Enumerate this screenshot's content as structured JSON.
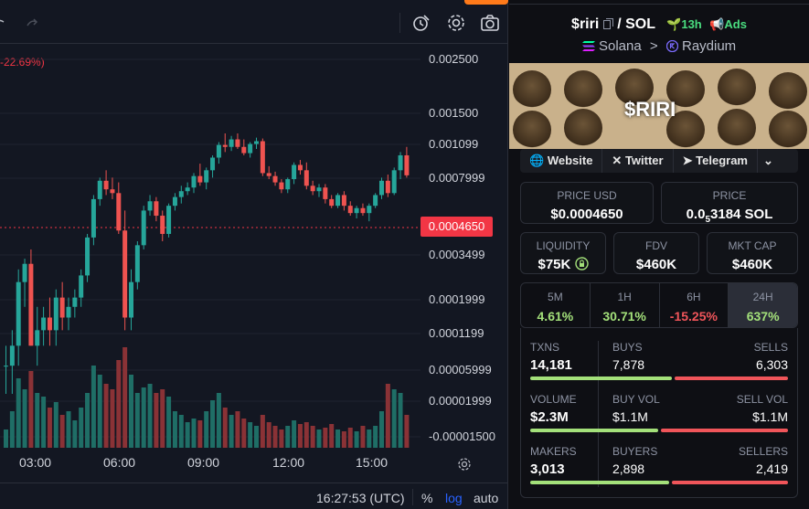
{
  "chart": {
    "change": "-22.69%)",
    "current_price": "0.0004650",
    "y_ticks": [
      "0.002500",
      "0.001500",
      "0.001099",
      "0.0007999",
      "0.0003499",
      "0.0001999",
      "0.0001199",
      "0.00005999",
      "0.00001999",
      "-0.00001500"
    ],
    "x_ticks": [
      "03:00",
      "06:00",
      "09:00",
      "12:00",
      "15:00"
    ],
    "time": "16:27:53 (UTC)",
    "percent": "%",
    "log": "log",
    "auto": "auto"
  },
  "chart_data": {
    "type": "candlestick",
    "x_ticks": [
      "03:00",
      "06:00",
      "09:00",
      "12:00",
      "15:00"
    ],
    "scale": "log",
    "candles": [
      {
        "o": 3e-05,
        "h": 4e-05,
        "l": 2e-05,
        "c": 3e-05,
        "v": 10
      },
      {
        "o": 3e-05,
        "h": 5e-05,
        "l": 2e-05,
        "c": 4e-05,
        "v": 20
      },
      {
        "o": 4e-05,
        "h": 0.00012,
        "l": 3e-05,
        "c": 0.0001,
        "v": 38
      },
      {
        "o": 0.0001,
        "h": 0.00014,
        "l": 7e-05,
        "c": 0.00013,
        "v": 32
      },
      {
        "o": 0.00013,
        "h": 0.00016,
        "l": 4e-05,
        "c": 4e-05,
        "v": 42
      },
      {
        "o": 4e-05,
        "h": 7e-05,
        "l": 3e-05,
        "c": 5e-05,
        "v": 30
      },
      {
        "o": 5e-05,
        "h": 7e-05,
        "l": 4e-05,
        "c": 6e-05,
        "v": 28
      },
      {
        "o": 6e-05,
        "h": 8e-05,
        "l": 4e-05,
        "c": 5e-05,
        "v": 22
      },
      {
        "o": 5e-05,
        "h": 9e-05,
        "l": 4e-05,
        "c": 8e-05,
        "v": 25
      },
      {
        "o": 8e-05,
        "h": 0.0001,
        "l": 5e-05,
        "c": 6e-05,
        "v": 18
      },
      {
        "o": 6e-05,
        "h": 8e-05,
        "l": 5e-05,
        "c": 7e-05,
        "v": 20
      },
      {
        "o": 7e-05,
        "h": 9e-05,
        "l": 6e-05,
        "c": 8e-05,
        "v": 15
      },
      {
        "o": 8e-05,
        "h": 0.00012,
        "l": 7e-05,
        "c": 0.00011,
        "v": 22
      },
      {
        "o": 0.00011,
        "h": 0.0002,
        "l": 0.0001,
        "c": 0.00019,
        "v": 30
      },
      {
        "o": 0.00019,
        "h": 0.00035,
        "l": 0.00017,
        "c": 0.00033,
        "v": 45
      },
      {
        "o": 0.00033,
        "h": 0.00045,
        "l": 0.0003,
        "c": 0.00043,
        "v": 40
      },
      {
        "o": 0.00043,
        "h": 0.0005,
        "l": 0.00035,
        "c": 0.00038,
        "v": 35
      },
      {
        "o": 0.00038,
        "h": 0.00045,
        "l": 0.00033,
        "c": 0.00036,
        "v": 32
      },
      {
        "o": 0.00036,
        "h": 0.00042,
        "l": 0.0002,
        "c": 0.00021,
        "v": 48
      },
      {
        "o": 0.00021,
        "h": 0.00028,
        "l": 5e-05,
        "c": 6e-05,
        "v": 55
      },
      {
        "o": 6e-05,
        "h": 0.00012,
        "l": 5e-05,
        "c": 0.0001,
        "v": 40
      },
      {
        "o": 0.0001,
        "h": 0.00018,
        "l": 9e-05,
        "c": 0.00017,
        "v": 30
      },
      {
        "o": 0.00017,
        "h": 0.0003,
        "l": 0.00016,
        "c": 0.00028,
        "v": 33
      },
      {
        "o": 0.00028,
        "h": 0.00035,
        "l": 0.00026,
        "c": 0.00032,
        "v": 35
      },
      {
        "o": 0.00032,
        "h": 0.00034,
        "l": 0.00024,
        "c": 0.00026,
        "v": 30
      },
      {
        "o": 0.00026,
        "h": 0.00028,
        "l": 0.00018,
        "c": 0.0002,
        "v": 32
      },
      {
        "o": 0.0002,
        "h": 0.00031,
        "l": 0.00019,
        "c": 0.0003,
        "v": 28
      },
      {
        "o": 0.0003,
        "h": 0.00036,
        "l": 0.00028,
        "c": 0.00034,
        "v": 20
      },
      {
        "o": 0.00034,
        "h": 0.0004,
        "l": 0.00031,
        "c": 0.00037,
        "v": 18
      },
      {
        "o": 0.00037,
        "h": 0.00042,
        "l": 0.00035,
        "c": 0.00039,
        "v": 14
      },
      {
        "o": 0.00039,
        "h": 0.00048,
        "l": 0.00036,
        "c": 0.00046,
        "v": 16
      },
      {
        "o": 0.00046,
        "h": 0.00055,
        "l": 0.0004,
        "c": 0.00042,
        "v": 15
      },
      {
        "o": 0.00042,
        "h": 0.00052,
        "l": 0.00038,
        "c": 0.0005,
        "v": 20
      },
      {
        "o": 0.0005,
        "h": 0.00062,
        "l": 0.00045,
        "c": 0.0006,
        "v": 26
      },
      {
        "o": 0.0006,
        "h": 0.00075,
        "l": 0.00055,
        "c": 0.00072,
        "v": 30
      },
      {
        "o": 0.00072,
        "h": 0.00085,
        "l": 0.00065,
        "c": 0.0007,
        "v": 22
      },
      {
        "o": 0.0007,
        "h": 0.00082,
        "l": 0.00066,
        "c": 0.00078,
        "v": 18
      },
      {
        "o": 0.00078,
        "h": 0.00085,
        "l": 0.00068,
        "c": 0.0007,
        "v": 20
      },
      {
        "o": 0.0007,
        "h": 0.00078,
        "l": 0.00062,
        "c": 0.00064,
        "v": 16
      },
      {
        "o": 0.00064,
        "h": 0.00075,
        "l": 0.0006,
        "c": 0.00073,
        "v": 14
      },
      {
        "o": 0.00073,
        "h": 0.0008,
        "l": 0.00068,
        "c": 0.00076,
        "v": 12
      },
      {
        "o": 0.00076,
        "h": 0.00079,
        "l": 0.00046,
        "c": 0.00048,
        "v": 18
      },
      {
        "o": 0.00048,
        "h": 0.00053,
        "l": 0.00044,
        "c": 0.00046,
        "v": 14
      },
      {
        "o": 0.00046,
        "h": 0.00049,
        "l": 0.0004,
        "c": 0.00042,
        "v": 12
      },
      {
        "o": 0.00042,
        "h": 0.00044,
        "l": 0.00036,
        "c": 0.00038,
        "v": 10
      },
      {
        "o": 0.00038,
        "h": 0.00045,
        "l": 0.00036,
        "c": 0.00044,
        "v": 12
      },
      {
        "o": 0.00044,
        "h": 0.00056,
        "l": 0.00041,
        "c": 0.00054,
        "v": 15
      },
      {
        "o": 0.00054,
        "h": 0.00058,
        "l": 0.00047,
        "c": 0.0005,
        "v": 13
      },
      {
        "o": 0.0005,
        "h": 0.00056,
        "l": 0.00038,
        "c": 0.0004,
        "v": 14
      },
      {
        "o": 0.0004,
        "h": 0.00043,
        "l": 0.00035,
        "c": 0.00037,
        "v": 12
      },
      {
        "o": 0.00037,
        "h": 0.00041,
        "l": 0.00034,
        "c": 0.00039,
        "v": 10
      },
      {
        "o": 0.00039,
        "h": 0.00041,
        "l": 0.00031,
        "c": 0.00033,
        "v": 11
      },
      {
        "o": 0.00033,
        "h": 0.00035,
        "l": 0.00029,
        "c": 0.0003,
        "v": 13
      },
      {
        "o": 0.0003,
        "h": 0.00036,
        "l": 0.00029,
        "c": 0.00035,
        "v": 10
      },
      {
        "o": 0.00035,
        "h": 0.00037,
        "l": 0.00028,
        "c": 0.0003,
        "v": 9
      },
      {
        "o": 0.0003,
        "h": 0.00032,
        "l": 0.00026,
        "c": 0.00027,
        "v": 11
      },
      {
        "o": 0.00027,
        "h": 0.0003,
        "l": 0.00025,
        "c": 0.00029,
        "v": 9
      },
      {
        "o": 0.00029,
        "h": 0.00031,
        "l": 0.00026,
        "c": 0.00027,
        "v": 12
      },
      {
        "o": 0.00027,
        "h": 0.00031,
        "l": 0.00024,
        "c": 0.0003,
        "v": 10
      },
      {
        "o": 0.0003,
        "h": 0.00036,
        "l": 0.00029,
        "c": 0.00035,
        "v": 12
      },
      {
        "o": 0.00035,
        "h": 0.00045,
        "l": 0.00033,
        "c": 0.00043,
        "v": 20
      },
      {
        "o": 0.00043,
        "h": 0.00047,
        "l": 0.00034,
        "c": 0.00036,
        "v": 35
      },
      {
        "o": 0.00036,
        "h": 0.00052,
        "l": 0.00035,
        "c": 0.0005,
        "v": 32
      },
      {
        "o": 0.0005,
        "h": 0.00065,
        "l": 0.00044,
        "c": 0.00062,
        "v": 30
      },
      {
        "o": 0.00062,
        "h": 0.0007,
        "l": 0.00045,
        "c": 0.000465,
        "v": 18
      }
    ]
  },
  "pair": {
    "token": "$riri",
    "quote": "/ SOL",
    "age": "13h",
    "ads": "Ads"
  },
  "chain": {
    "network": "Solana",
    "sep": ">",
    "dex": "Raydium"
  },
  "banner_title": "$RIRI",
  "links": {
    "website": "Website",
    "twitter": "Twitter",
    "telegram": "Telegram"
  },
  "price_usd": {
    "label": "PRICE USD",
    "value": "$0.0004650"
  },
  "price_sol": {
    "label": "PRICE",
    "value_prefix": "0.0",
    "value_sub": "5",
    "value_suffix": "3184 SOL"
  },
  "liquidity": {
    "label": "LIQUIDITY",
    "value": "$75K"
  },
  "fdv": {
    "label": "FDV",
    "value": "$460K"
  },
  "mcap": {
    "label": "MKT CAP",
    "value": "$460K"
  },
  "timeframes": [
    {
      "label": "5M",
      "value": "4.61%",
      "color": "#a3e07a"
    },
    {
      "label": "1H",
      "value": "30.71%",
      "color": "#a3e07a"
    },
    {
      "label": "6H",
      "value": "-15.25%",
      "color": "#f0555a"
    },
    {
      "label": "24H",
      "value": "637%",
      "color": "#a3e07a"
    }
  ],
  "stats": {
    "txns": {
      "label": "TXNS",
      "value": "14,181",
      "buys_label": "BUYS",
      "buys": "7,878",
      "sells_label": "SELLS",
      "sells": "6,303",
      "buy_ratio": 0.555
    },
    "volume": {
      "label": "VOLUME",
      "value": "$2.3M",
      "buy_label": "BUY VOL",
      "buy": "$1.1M",
      "sell_label": "SELL VOL",
      "sell": "$1.1M",
      "buy_ratio": 0.5
    },
    "makers": {
      "label": "MAKERS",
      "value": "3,013",
      "buyers_label": "BUYERS",
      "buyers": "2,898",
      "sellers_label": "SELLERS",
      "sellers": "2,419",
      "buy_ratio": 0.545
    }
  }
}
